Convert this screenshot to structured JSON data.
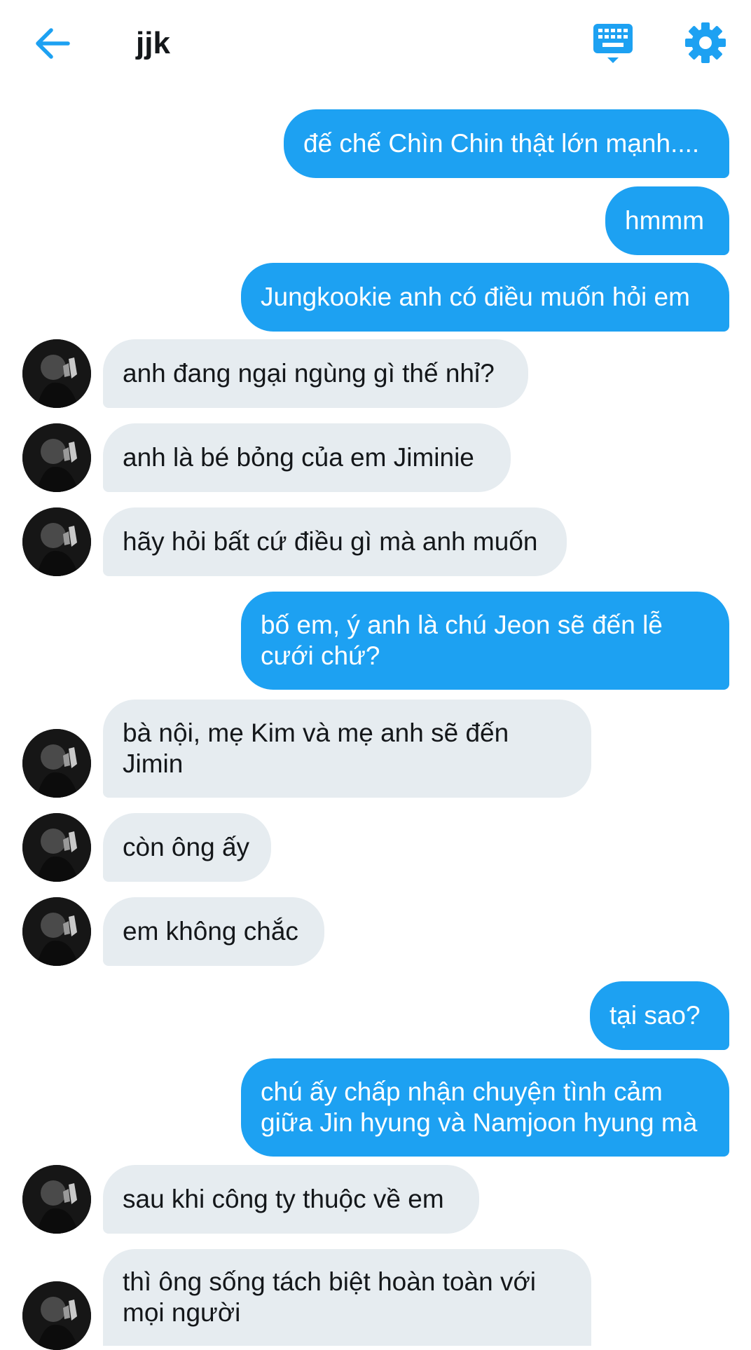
{
  "header": {
    "title": "jjk",
    "back_icon": "arrow-left-icon",
    "keyboard_icon": "keyboard-icon",
    "settings_icon": "gear-icon",
    "accent_color": "#1da1f2"
  },
  "messages": [
    {
      "direction": "sent",
      "text": "đế chế Chìn Chin thật lớn mạnh...."
    },
    {
      "direction": "sent",
      "text": "hmmm"
    },
    {
      "direction": "sent",
      "text": "Jungkookie anh có điều muốn hỏi em"
    },
    {
      "direction": "received",
      "text": "anh đang ngại ngùng gì thế nhỉ?"
    },
    {
      "direction": "received",
      "text": "anh là bé bỏng của em Jiminie"
    },
    {
      "direction": "received",
      "text": "hãy hỏi bất cứ điều gì mà anh muốn"
    },
    {
      "direction": "sent",
      "text": "bố em, ý anh là chú Jeon sẽ đến lễ cưới chứ?"
    },
    {
      "direction": "received",
      "text": "bà nội, mẹ Kim và mẹ anh sẽ đến Jimin"
    },
    {
      "direction": "received",
      "text": "còn ông ấy"
    },
    {
      "direction": "received",
      "text": "em không chắc"
    },
    {
      "direction": "sent",
      "text": "tại sao?"
    },
    {
      "direction": "sent",
      "text": "chú ấy chấp nhận chuyện tình cảm giữa Jin hyung và Namjoon hyung mà"
    },
    {
      "direction": "received",
      "text": "sau khi công ty thuộc về em"
    },
    {
      "direction": "received",
      "text": "thì ông sống tách biệt hoàn toàn với mọi người"
    }
  ],
  "colors": {
    "sent_bubble": "#1da1f2",
    "received_bubble": "#e6ecf0",
    "text_dark": "#14171a"
  }
}
